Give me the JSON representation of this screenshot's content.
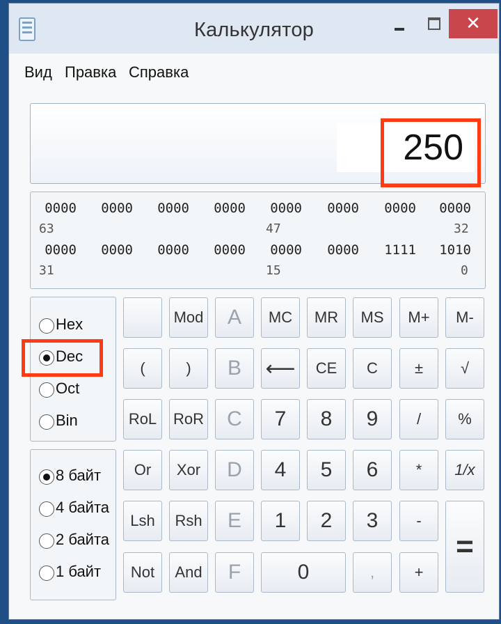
{
  "window": {
    "title": "Калькулятор",
    "close_glyph": "✕",
    "icons": [
      "calculator-icon",
      "minimize-icon",
      "maximize-icon",
      "close-icon"
    ]
  },
  "menu": [
    "Вид",
    "Правка",
    "Справка"
  ],
  "display": {
    "value": "250"
  },
  "binary": {
    "row1": [
      "0000",
      "0000",
      "0000",
      "0000",
      "0000",
      "0000",
      "0000",
      "0000"
    ],
    "row1_idx": [
      "63",
      "47",
      "32"
    ],
    "row2": [
      "0000",
      "0000",
      "0000",
      "0000",
      "0000",
      "0000",
      "1111",
      "1010"
    ],
    "row2_idx": [
      "31",
      "15",
      "0"
    ]
  },
  "base_options": [
    {
      "label": "Hex",
      "checked": false
    },
    {
      "label": "Dec",
      "checked": true
    },
    {
      "label": "Oct",
      "checked": false
    },
    {
      "label": "Bin",
      "checked": false
    }
  ],
  "size_options": [
    {
      "label": "8 байт",
      "checked": true
    },
    {
      "label": "4 байта",
      "checked": false
    },
    {
      "label": "2 байта",
      "checked": false
    },
    {
      "label": "1 байт",
      "checked": false
    }
  ],
  "keys": {
    "blank": "",
    "mod": "Mod",
    "a": "A",
    "mc": "MC",
    "mr": "MR",
    "ms": "MS",
    "mplus": "M+",
    "mminus": "M-",
    "lparen": "(",
    "rparen": ")",
    "b": "B",
    "back": "⟵",
    "ce": "CE",
    "c": "C",
    "plusminus": "±",
    "sqrt": "√",
    "rol": "RoL",
    "ror": "RoR",
    "hex_c": "C",
    "d7": "7",
    "d8": "8",
    "d9": "9",
    "div": "/",
    "pct": "%",
    "or": "Or",
    "xor": "Xor",
    "d": "D",
    "d4": "4",
    "d5": "5",
    "d6": "6",
    "mul": "*",
    "recip": "1/x",
    "lsh": "Lsh",
    "rsh": "Rsh",
    "e": "E",
    "d1": "1",
    "d2": "2",
    "d3": "3",
    "minus": "-",
    "equals": "=",
    "not": "Not",
    "and": "And",
    "f": "F",
    "d0": "0",
    "comma": ",",
    "plus": "+"
  },
  "highlight_color": "#ff3b14"
}
